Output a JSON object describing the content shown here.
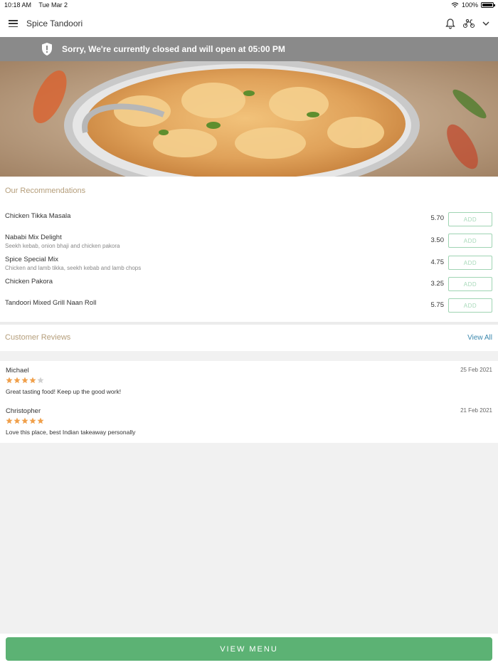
{
  "status_bar": {
    "time": "10:18 AM",
    "date": "Tue Mar 2",
    "battery": "100%"
  },
  "header": {
    "title": "Spice Tandoori",
    "icons": [
      "menu-icon",
      "bell-icon",
      "scooter-icon",
      "chevron-down-icon"
    ]
  },
  "banner": {
    "text": "Sorry, We're currently closed and will open at 05:00 PM",
    "icon": "shield-alert-icon"
  },
  "recommendations": {
    "title": "Our Recommendations",
    "items": [
      {
        "name": "Chicken Tikka Masala",
        "desc": "",
        "price": "5.70",
        "action": "ADD"
      },
      {
        "name": "Nababi Mix Delight",
        "desc": "Seekh kebab, onion bhaji and chicken pakora",
        "price": "3.50",
        "action": "ADD"
      },
      {
        "name": "Spice Special Mix",
        "desc": "Chicken and lamb tikka, seekh kebab and lamb chops",
        "price": "4.75",
        "action": "ADD"
      },
      {
        "name": "Chicken Pakora",
        "desc": "",
        "price": "3.25",
        "action": "ADD"
      },
      {
        "name": "Tandoori Mixed Grill Naan Roll",
        "desc": "",
        "price": "5.75",
        "action": "ADD"
      }
    ]
  },
  "reviews": {
    "title": "Customer Reviews",
    "view_all": "View All",
    "items": [
      {
        "name": "Michael",
        "date": "25 Feb 2021",
        "rating": 4,
        "text": "Great tasting food! Keep up the good work!"
      },
      {
        "name": "Christopher",
        "date": "21 Feb 2021",
        "rating": 5,
        "text": "Love this place, best Indian takeaway personally"
      }
    ]
  },
  "footer": {
    "button_label": "VIEW MENU"
  },
  "colors": {
    "accent_green": "#5cb274",
    "section_title": "#b59e7b",
    "banner_bg": "#8a8a8a",
    "star_filled": "#f0a04b",
    "star_empty": "#cfcfcf",
    "link_blue": "#3a87ad"
  }
}
